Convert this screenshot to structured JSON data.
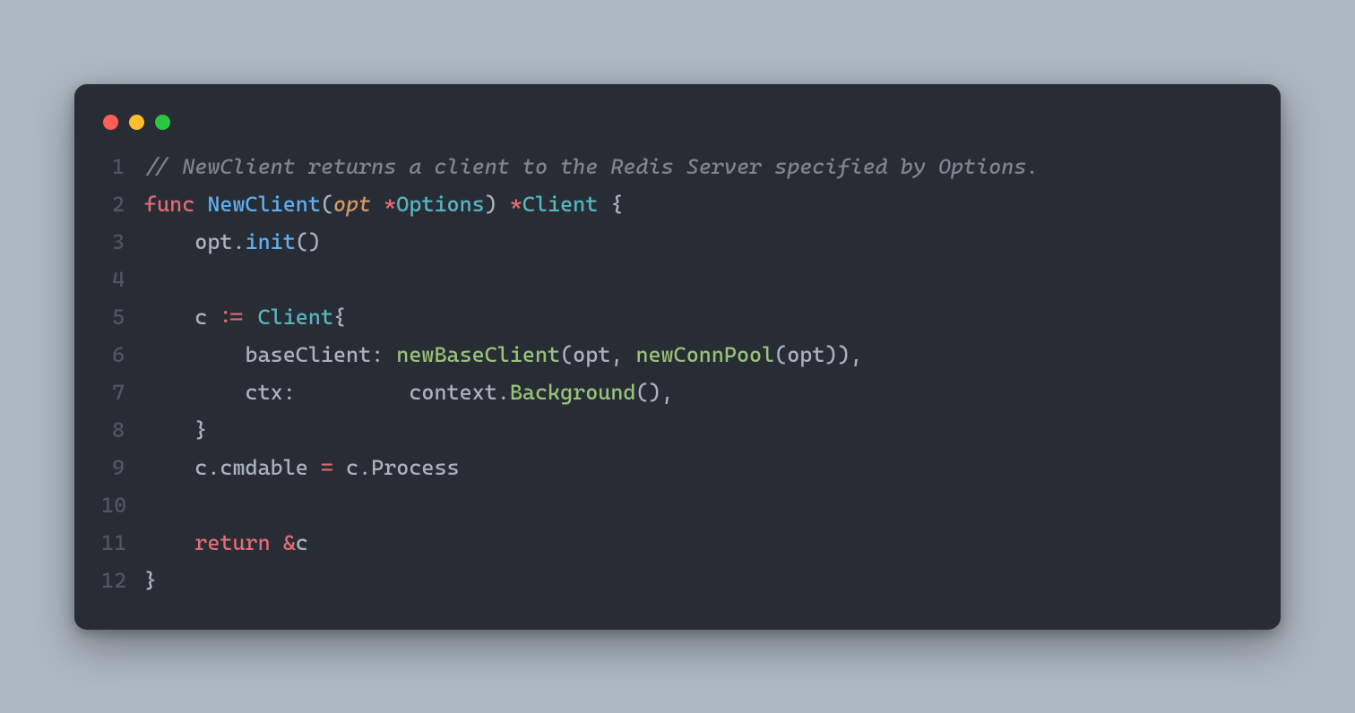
{
  "window": {
    "traffic_lights": [
      "red",
      "yellow",
      "green"
    ]
  },
  "code": {
    "lines": [
      {
        "n": "1",
        "tokens": [
          {
            "t": "// NewClient returns a client to the Redis Server specified by Options.",
            "c": "c-comment"
          }
        ]
      },
      {
        "n": "2",
        "tokens": [
          {
            "t": "func",
            "c": "c-kw"
          },
          {
            "t": " ",
            "c": ""
          },
          {
            "t": "NewClient",
            "c": "c-fn"
          },
          {
            "t": "(",
            "c": "c-punc"
          },
          {
            "t": "opt",
            "c": "c-param"
          },
          {
            "t": " ",
            "c": ""
          },
          {
            "t": "*",
            "c": "c-op"
          },
          {
            "t": "Options",
            "c": "c-type"
          },
          {
            "t": ")",
            "c": "c-punc"
          },
          {
            "t": " ",
            "c": ""
          },
          {
            "t": "*",
            "c": "c-op"
          },
          {
            "t": "Client",
            "c": "c-type"
          },
          {
            "t": " ",
            "c": ""
          },
          {
            "t": "{",
            "c": "c-punc"
          }
        ]
      },
      {
        "n": "3",
        "tokens": [
          {
            "t": "    ",
            "c": ""
          },
          {
            "t": "opt",
            "c": "c-ident"
          },
          {
            "t": ".",
            "c": "c-punc"
          },
          {
            "t": "init",
            "c": "c-fn"
          },
          {
            "t": "()",
            "c": "c-punc"
          }
        ]
      },
      {
        "n": "4",
        "tokens": [
          {
            "t": "",
            "c": ""
          }
        ]
      },
      {
        "n": "5",
        "tokens": [
          {
            "t": "    ",
            "c": ""
          },
          {
            "t": "c",
            "c": "c-ident"
          },
          {
            "t": " ",
            "c": ""
          },
          {
            "t": ":=",
            "c": "c-assign"
          },
          {
            "t": " ",
            "c": ""
          },
          {
            "t": "Client",
            "c": "c-type"
          },
          {
            "t": "{",
            "c": "c-punc"
          }
        ]
      },
      {
        "n": "6",
        "tokens": [
          {
            "t": "        ",
            "c": ""
          },
          {
            "t": "baseClient",
            "c": "c-field"
          },
          {
            "t": ":",
            "c": "c-punc"
          },
          {
            "t": " ",
            "c": ""
          },
          {
            "t": "newBaseClient",
            "c": "c-call"
          },
          {
            "t": "(",
            "c": "c-punc"
          },
          {
            "t": "opt",
            "c": "c-ident"
          },
          {
            "t": ",",
            "c": "c-punc"
          },
          {
            "t": " ",
            "c": ""
          },
          {
            "t": "newConnPool",
            "c": "c-call"
          },
          {
            "t": "(",
            "c": "c-punc"
          },
          {
            "t": "opt",
            "c": "c-ident"
          },
          {
            "t": "))",
            "c": "c-punc"
          },
          {
            "t": ",",
            "c": "c-punc"
          }
        ]
      },
      {
        "n": "7",
        "tokens": [
          {
            "t": "        ",
            "c": ""
          },
          {
            "t": "ctx",
            "c": "c-field"
          },
          {
            "t": ":",
            "c": "c-punc"
          },
          {
            "t": "         ",
            "c": ""
          },
          {
            "t": "context",
            "c": "c-ident"
          },
          {
            "t": ".",
            "c": "c-punc"
          },
          {
            "t": "Background",
            "c": "c-call"
          },
          {
            "t": "()",
            "c": "c-punc"
          },
          {
            "t": ",",
            "c": "c-punc"
          }
        ]
      },
      {
        "n": "8",
        "tokens": [
          {
            "t": "    ",
            "c": ""
          },
          {
            "t": "}",
            "c": "c-punc"
          }
        ]
      },
      {
        "n": "9",
        "tokens": [
          {
            "t": "    ",
            "c": ""
          },
          {
            "t": "c",
            "c": "c-ident"
          },
          {
            "t": ".",
            "c": "c-punc"
          },
          {
            "t": "cmdable",
            "c": "c-ident"
          },
          {
            "t": " ",
            "c": ""
          },
          {
            "t": "=",
            "c": "c-assign"
          },
          {
            "t": " ",
            "c": ""
          },
          {
            "t": "c",
            "c": "c-ident"
          },
          {
            "t": ".",
            "c": "c-punc"
          },
          {
            "t": "Process",
            "c": "c-ident"
          }
        ]
      },
      {
        "n": "10",
        "tokens": [
          {
            "t": "",
            "c": ""
          }
        ]
      },
      {
        "n": "11",
        "tokens": [
          {
            "t": "    ",
            "c": ""
          },
          {
            "t": "return",
            "c": "c-kw"
          },
          {
            "t": " ",
            "c": ""
          },
          {
            "t": "&",
            "c": "c-op"
          },
          {
            "t": "c",
            "c": "c-ident"
          }
        ]
      },
      {
        "n": "12",
        "tokens": [
          {
            "t": "}",
            "c": "c-punc"
          }
        ]
      }
    ]
  }
}
